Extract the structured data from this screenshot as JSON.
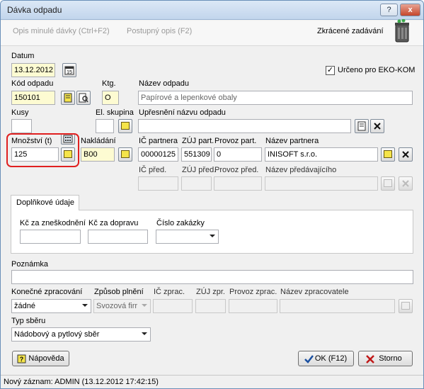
{
  "window": {
    "title": "Dávka odpadu",
    "help_btn": "?",
    "close_btn": "x"
  },
  "toolbar": {
    "prev_batch": "Opis minulé dávky (Ctrl+F2)",
    "progressive": "Postupný opis (F2)",
    "short_entry": "Zkrácené zadávání"
  },
  "form": {
    "datum_label": "Datum",
    "datum_value": "13.12.2012",
    "eko_label": "Určeno pro EKO-KOM",
    "eko_checked": "✓",
    "kod_label": "Kód odpadu",
    "kod_value": "150101",
    "ktg_label": "Ktg.",
    "ktg_value": "O",
    "nazev_label": "Název odpadu",
    "nazev_value": "Papírové a lepenkové obaly",
    "kusy_label": "Kusy",
    "kusy_value": "",
    "skupina_label": "El. skupina",
    "skupina_value": "",
    "upresneni_label": "Upřesnění názvu odpadu",
    "upresneni_value": "",
    "mnozstvi_label": "Množství (t)",
    "mnozstvi_value": "125",
    "nakladani_label": "Nakládání",
    "nakladani_value": "B00",
    "ic_partnera_label": "IČ partnera",
    "ic_partnera_value": "00000125",
    "zuj_part_label": "ZÚJ part.",
    "zuj_part_value": "551309",
    "provoz_part_label": "Provoz part.",
    "provoz_part_value": "0",
    "nazev_partnera_label": "Název partnera",
    "nazev_partnera_value": "INISOFT s.r.o.",
    "ic_pred_label": "IČ před.",
    "zuj_pred_label": "ZÚJ před.",
    "provoz_pred_label": "Provoz před.",
    "nazev_pred_label": "Název předávajícího"
  },
  "extra": {
    "tab_label": "Doplňkové údaje",
    "kc_znesk_label": "Kč za zneškodnění",
    "kc_doprava_label": "Kč za dopravu",
    "cislo_zakazky_label": "Číslo zakázky"
  },
  "bottom": {
    "poznamka_label": "Poznámka",
    "konecne_label": "Konečné zpracování",
    "konecne_value": "žádné",
    "zpusob_label": "Způsob plnění",
    "zpusob_value": "Svozová firr",
    "ic_zprac_label": "IČ zprac.",
    "zuj_zpr_label": "ZÚJ zpr.",
    "provoz_zprac_label": "Provoz zprac.",
    "nazev_zprac_label": "Název zpracovatele",
    "typ_sberu_label": "Typ sběru",
    "typ_sberu_value": "Nádobový a pytlový sběr"
  },
  "buttons": {
    "help": "Nápověda",
    "ok": "OK (F12)",
    "cancel": "Storno"
  },
  "status": "Nový záznam: ADMIN (13.12.2012 17:42:15)"
}
